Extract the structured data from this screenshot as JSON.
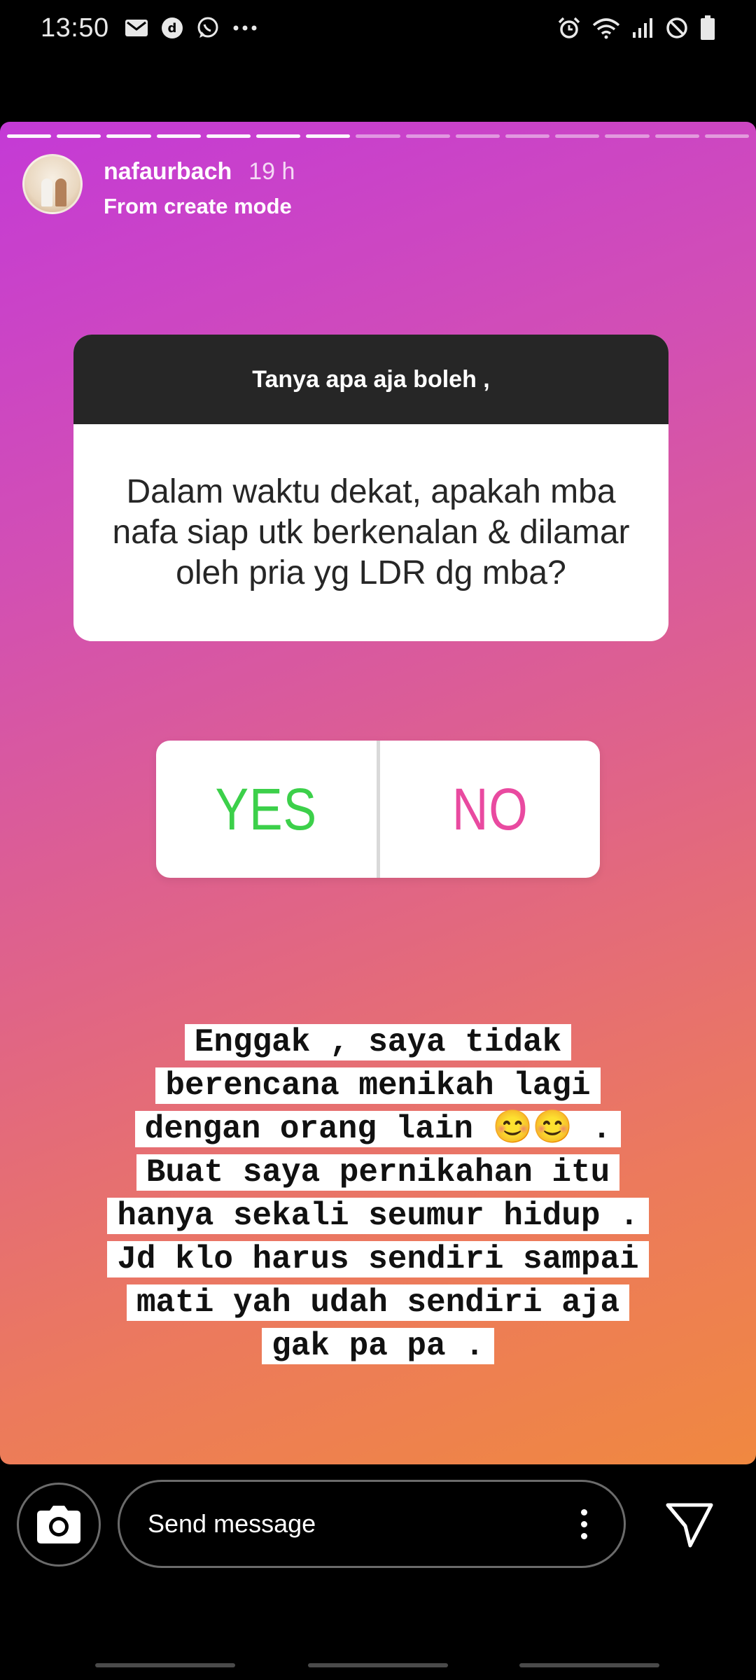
{
  "status_bar": {
    "time": "13:50",
    "left_icons": [
      "gmail-icon",
      "dana-icon",
      "whatsapp-icon",
      "more-dots-icon"
    ],
    "right_icons": [
      "alarm-icon",
      "wifi-icon",
      "signal-icon",
      "do-not-disturb-icon",
      "battery-icon"
    ]
  },
  "story": {
    "progress": {
      "total_segments": 15,
      "completed_segments": 7
    },
    "user": {
      "username": "nafaurbach",
      "time_ago": "19 h",
      "subtitle": "From create mode"
    },
    "question_sticker": {
      "prompt": "Tanya apa aja boleh ,",
      "question": "Dalam waktu dekat, apakah mba nafa siap utk berkenalan & dilamar oleh pria yg LDR dg mba?"
    },
    "poll": {
      "yes_label": "YES",
      "no_label": "NO",
      "yes_color": "#3cd04a",
      "no_color": "#e94aa0"
    },
    "answer_lines": [
      "Enggak , saya tidak",
      "berencana menikah lagi",
      "dengan orang lain 😊😊 .",
      "Buat saya pernikahan itu",
      "hanya sekali seumur hidup .",
      "Jd klo harus sendiri sampai",
      "mati yah udah sendiri aja",
      "gak pa pa ."
    ],
    "gradient_colors": [
      "#c43ad6",
      "#e06487",
      "#f08840"
    ]
  },
  "bottom_bar": {
    "message_placeholder": "Send message"
  }
}
